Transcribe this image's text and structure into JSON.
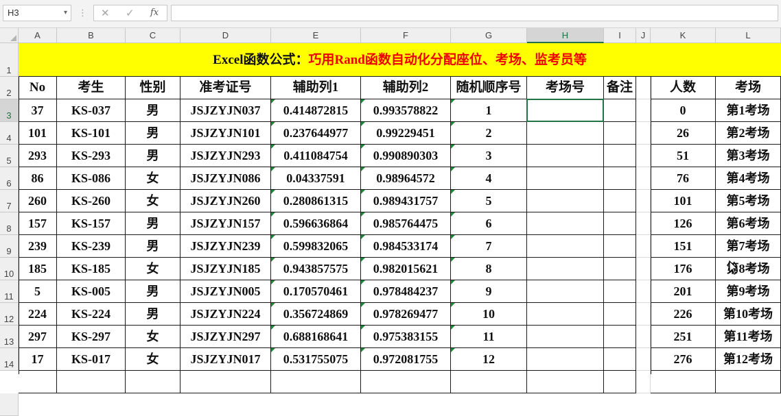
{
  "name_box": "H3",
  "formula": "",
  "columns": [
    "A",
    "B",
    "C",
    "D",
    "E",
    "F",
    "G",
    "H",
    "I",
    "J",
    "K",
    "L"
  ],
  "selected_column": "H",
  "selected_row": "3",
  "title": {
    "black": "Excel函数公式：",
    "red": "巧用Rand函数自动化分配座位、考场、监考员等"
  },
  "headers": [
    "No",
    "考生",
    "性别",
    "准考证号",
    "辅助列1",
    "辅助列2",
    "随机顺序号",
    "考场号",
    "备注"
  ],
  "side_headers": [
    "人数",
    "考场"
  ],
  "rows": [
    {
      "row": "3",
      "cells": [
        "37",
        "KS-037",
        "男",
        "JSJZYJN037",
        "0.414872815",
        "0.993578822",
        "1",
        "",
        ""
      ],
      "side": [
        "0",
        "第1考场"
      ]
    },
    {
      "row": "4",
      "cells": [
        "101",
        "KS-101",
        "男",
        "JSJZYJN101",
        "0.237644977",
        "0.99229451",
        "2",
        "",
        ""
      ],
      "side": [
        "26",
        "第2考场"
      ]
    },
    {
      "row": "5",
      "cells": [
        "293",
        "KS-293",
        "男",
        "JSJZYJN293",
        "0.411084754",
        "0.990890303",
        "3",
        "",
        ""
      ],
      "side": [
        "51",
        "第3考场"
      ]
    },
    {
      "row": "6",
      "cells": [
        "86",
        "KS-086",
        "女",
        "JSJZYJN086",
        "0.04337591",
        "0.98964572",
        "4",
        "",
        ""
      ],
      "side": [
        "76",
        "第4考场"
      ]
    },
    {
      "row": "7",
      "cells": [
        "260",
        "KS-260",
        "女",
        "JSJZYJN260",
        "0.280861315",
        "0.989431757",
        "5",
        "",
        ""
      ],
      "side": [
        "101",
        "第5考场"
      ]
    },
    {
      "row": "8",
      "cells": [
        "157",
        "KS-157",
        "男",
        "JSJZYJN157",
        "0.596636864",
        "0.985764475",
        "6",
        "",
        ""
      ],
      "side": [
        "126",
        "第6考场"
      ]
    },
    {
      "row": "9",
      "cells": [
        "239",
        "KS-239",
        "男",
        "JSJZYJN239",
        "0.599832065",
        "0.984533174",
        "7",
        "",
        ""
      ],
      "side": [
        "151",
        "第7考场"
      ]
    },
    {
      "row": "10",
      "cells": [
        "185",
        "KS-185",
        "女",
        "JSJZYJN185",
        "0.943857575",
        "0.982015621",
        "8",
        "",
        ""
      ],
      "side": [
        "176",
        "第8考场"
      ]
    },
    {
      "row": "11",
      "cells": [
        "5",
        "KS-005",
        "男",
        "JSJZYJN005",
        "0.170570461",
        "0.978484237",
        "9",
        "",
        ""
      ],
      "side": [
        "201",
        "第9考场"
      ]
    },
    {
      "row": "12",
      "cells": [
        "224",
        "KS-224",
        "男",
        "JSJZYJN224",
        "0.356724869",
        "0.978269477",
        "10",
        "",
        ""
      ],
      "side": [
        "226",
        "第10考场"
      ]
    },
    {
      "row": "13",
      "cells": [
        "297",
        "KS-297",
        "女",
        "JSJZYJN297",
        "0.688168641",
        "0.975383155",
        "11",
        "",
        ""
      ],
      "side": [
        "251",
        "第11考场"
      ]
    },
    {
      "row": "14",
      "cells": [
        "17",
        "KS-017",
        "女",
        "JSJZYJN017",
        "0.531755075",
        "0.972081755",
        "12",
        "",
        ""
      ],
      "side": [
        "276",
        "第12考场"
      ]
    }
  ],
  "icons": {
    "cancel": "x-icon",
    "enter": "check-icon",
    "function": "fx-icon",
    "cursor": "mouse-pointer-icon"
  },
  "colors": {
    "title_bg": "#ffff00",
    "title_red": "#ee0000",
    "selection": "#217346",
    "number_stored_as_text_flag": "#1e8a3a"
  }
}
